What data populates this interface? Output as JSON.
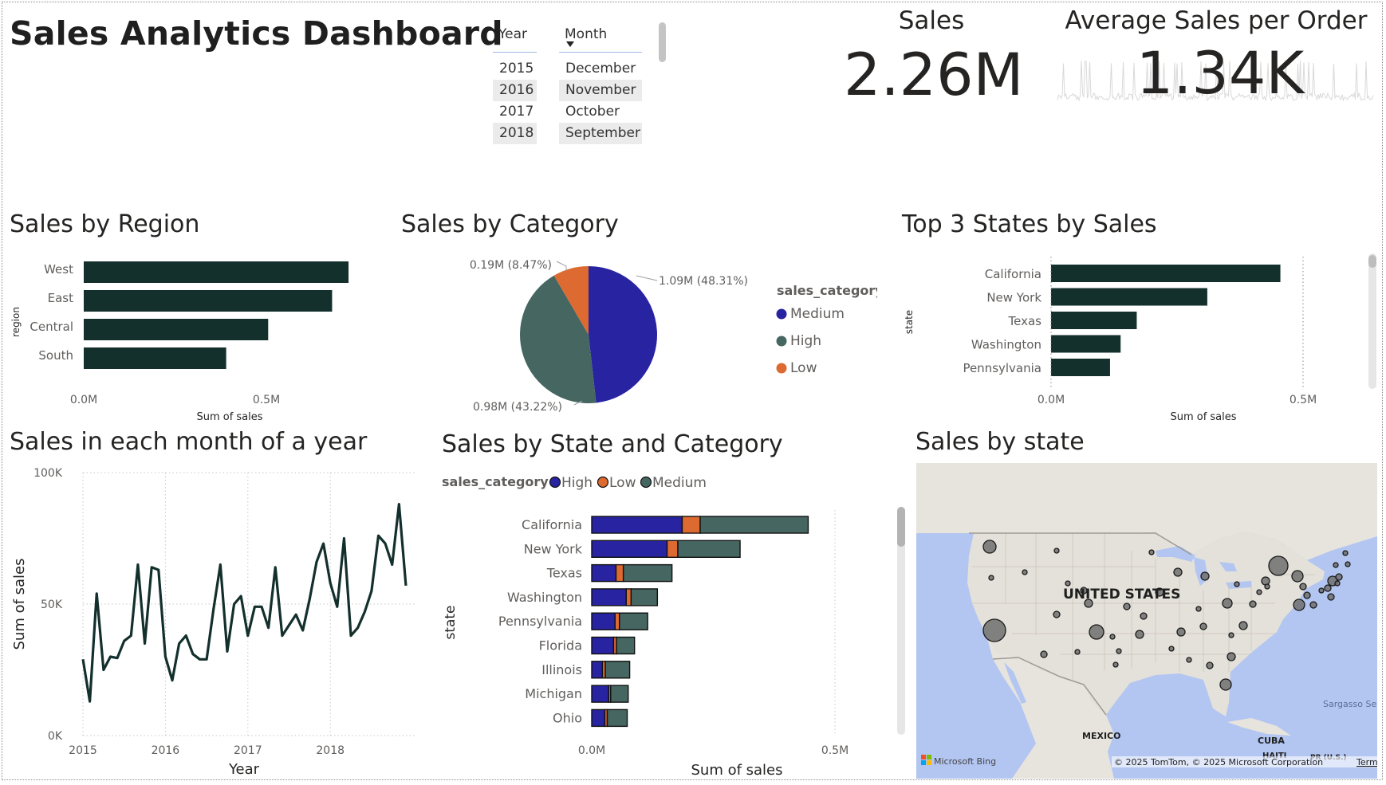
{
  "header": {
    "title": "Sales Analytics Dashboard"
  },
  "slicers": {
    "year": {
      "label": "Year",
      "items": [
        "2015",
        "2016",
        "2017",
        "2018"
      ],
      "selected": [
        "2016",
        "2018"
      ]
    },
    "month": {
      "label": "Month",
      "items": [
        "December",
        "November",
        "October",
        "September"
      ],
      "selected": [
        "November",
        "September"
      ]
    }
  },
  "cards": {
    "sales": {
      "label": "Sales",
      "value": "2.26M"
    },
    "avg": {
      "label": "Average Sales per Order",
      "value": "1.34K"
    }
  },
  "visuals": {
    "region": {
      "title": "Sales by Region",
      "chart_data": {
        "type": "bar",
        "orientation": "horizontal",
        "categories": [
          "West",
          "East",
          "Central",
          "South"
        ],
        "values": [
          0.725,
          0.68,
          0.505,
          0.39
        ],
        "xlabel": "Sum of sales",
        "ylabel": "region",
        "xticks": [
          "0.0M",
          "0.5M"
        ],
        "xlim": [
          0,
          0.82
        ],
        "color": "#13302c"
      }
    },
    "category": {
      "title": "Sales by Category",
      "chart_data": {
        "type": "pie",
        "slices": [
          {
            "name": "Medium",
            "value": 1.09,
            "label": "1.09M (48.31%)",
            "color": "#2823a0"
          },
          {
            "name": "High",
            "value": 0.98,
            "label": "0.98M (43.22%)",
            "color": "#466661"
          },
          {
            "name": "Low",
            "value": 0.19,
            "label": "0.19M (8.47%)",
            "color": "#dc6a31"
          }
        ],
        "legend_title": "sales_category",
        "legend_position": "right"
      }
    },
    "topstates": {
      "title": "Top 3 States by Sales",
      "chart_data": {
        "type": "bar",
        "orientation": "horizontal",
        "categories": [
          "California",
          "New York",
          "Texas",
          "Washington",
          "Pennsylvania"
        ],
        "values": [
          0.455,
          0.31,
          0.17,
          0.138,
          0.117
        ],
        "xlabel": "Sum of sales",
        "ylabel": "state",
        "xticks": [
          "0.0M",
          "0.5M"
        ],
        "xlim": [
          0,
          0.5
        ],
        "color": "#13302c"
      }
    },
    "monthly": {
      "title": "Sales in each month of a year",
      "chart_data": {
        "type": "line",
        "x_start": "2015-01",
        "values": [
          29000,
          13000,
          54000,
          25000,
          30000,
          29500,
          36000,
          38000,
          65000,
          35000,
          64000,
          63000,
          30000,
          21000,
          35000,
          38000,
          31000,
          29000,
          29000,
          48000,
          65000,
          32000,
          50000,
          53000,
          38000,
          49000,
          49000,
          41000,
          64000,
          38000,
          42000,
          46000,
          40000,
          52000,
          66000,
          73000,
          58000,
          49000,
          75000,
          38000,
          41000,
          47000,
          55000,
          76000,
          73000,
          65000,
          88000,
          57000
        ],
        "xlabel": "Year",
        "ylabel": "Sum of sales",
        "xticks": [
          "2015",
          "2016",
          "2017",
          "2018"
        ],
        "yticks": [
          "0K",
          "50K",
          "100K"
        ],
        "ylim": [
          0,
          100000
        ],
        "color": "#13302c",
        "grid": true
      }
    },
    "statecat": {
      "title": "Sales by State and Category",
      "chart_data": {
        "type": "bar",
        "orientation": "horizontal",
        "stacked": true,
        "categories": [
          "California",
          "New York",
          "Texas",
          "Washington",
          "Pennsylvania",
          "Florida",
          "Illinois",
          "Michigan",
          "Ohio"
        ],
        "series": [
          {
            "name": "High",
            "color": "#2823a0",
            "values": [
              0.186,
              0.155,
              0.05,
              0.071,
              0.048,
              0.045,
              0.022,
              0.035,
              0.027
            ]
          },
          {
            "name": "Low",
            "color": "#dc6a31",
            "values": [
              0.037,
              0.022,
              0.015,
              0.01,
              0.009,
              0.006,
              0.006,
              0.004,
              0.005
            ]
          },
          {
            "name": "Medium",
            "color": "#466661",
            "values": [
              0.222,
              0.128,
              0.1,
              0.054,
              0.058,
              0.037,
              0.05,
              0.036,
              0.041
            ]
          }
        ],
        "legend_title": "sales_category",
        "legend_order": [
          "High",
          "Low",
          "Medium"
        ],
        "xlabel": "Sum of sales",
        "ylabel": "state",
        "xticks": [
          "0.0M",
          "0.5M"
        ],
        "xlim": [
          0,
          0.5
        ]
      }
    },
    "map": {
      "title": "Sales by state",
      "labels": {
        "country": "UNITED STATES",
        "mexico": "MEXICO",
        "cuba": "CUBA",
        "haiti": "HAITI",
        "pr": "PR (U.S.)",
        "sargasso": "Sargasso Se"
      },
      "attribution": "© 2025 TomTom, © 2025 Microsoft Corporation",
      "terms": "Terms",
      "brand": "Microsoft Bing"
    }
  }
}
